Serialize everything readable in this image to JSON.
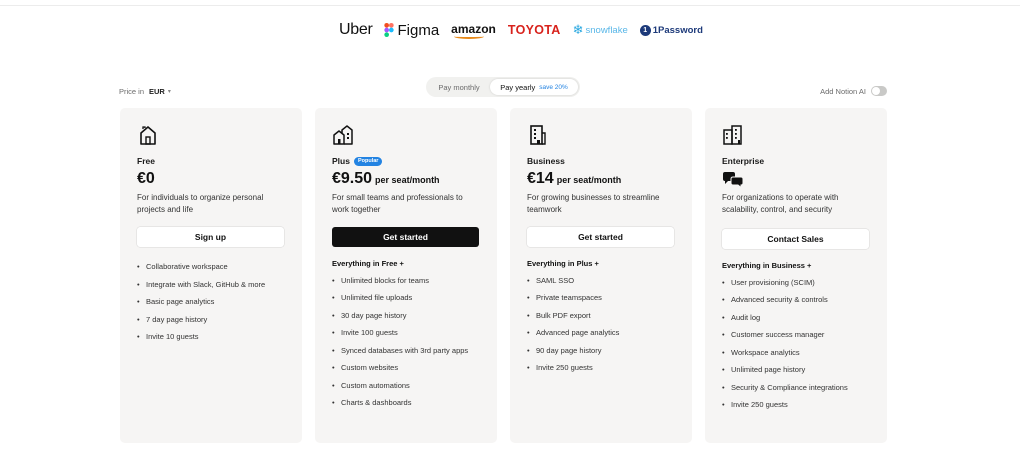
{
  "logos": [
    "Uber",
    "Figma",
    "amazon",
    "TOYOTA",
    "snowflake",
    "1Password"
  ],
  "controls": {
    "price_in_label": "Price in",
    "currency": "EUR",
    "billing_monthly": "Pay monthly",
    "billing_yearly": "Pay yearly",
    "yearly_save": "save 20%",
    "notion_ai_label": "Add Notion AI",
    "notion_ai_enabled": false
  },
  "colors": {
    "accent_blue": "#2383e2",
    "card_bg": "#f6f5f4",
    "primary_button": "#111111"
  },
  "plans": [
    {
      "name": "Free",
      "badge": "",
      "price": "€0",
      "per": "",
      "description": "For individuals to organize personal projects and life",
      "cta": "Sign up",
      "includes": "",
      "features": [
        "Collaborative workspace",
        "Integrate with Slack, GitHub & more",
        "Basic page analytics",
        "7 day page history",
        "Invite 10 guests"
      ]
    },
    {
      "name": "Plus",
      "badge": "Popular",
      "price": "€9.50",
      "per": "per seat/month",
      "description": "For small teams and professionals to work together",
      "cta": "Get started",
      "includes": "Everything in Free +",
      "features": [
        "Unlimited blocks for teams",
        "Unlimited file uploads",
        "30 day page history",
        "Invite 100 guests",
        "Synced databases with 3rd party apps",
        "Custom websites",
        "Custom automations",
        "Charts & dashboards"
      ]
    },
    {
      "name": "Business",
      "badge": "",
      "price": "€14",
      "per": "per seat/month",
      "description": "For growing businesses to streamline teamwork",
      "cta": "Get started",
      "includes": "Everything in Plus +",
      "features": [
        "SAML SSO",
        "Private teamspaces",
        "Bulk PDF export",
        "Advanced page analytics",
        "90 day page history",
        "Invite 250 guests"
      ]
    },
    {
      "name": "Enterprise",
      "badge": "",
      "price": "",
      "per": "",
      "description": "For organizations to operate with scalability, control, and security",
      "cta": "Contact Sales",
      "includes": "Everything in Business +",
      "features": [
        "User provisioning (SCIM)",
        "Advanced security & controls",
        "Audit log",
        "Customer success manager",
        "Workspace analytics",
        "Unlimited page history",
        "Security & Compliance integrations",
        "Invite 250 guests"
      ]
    }
  ]
}
